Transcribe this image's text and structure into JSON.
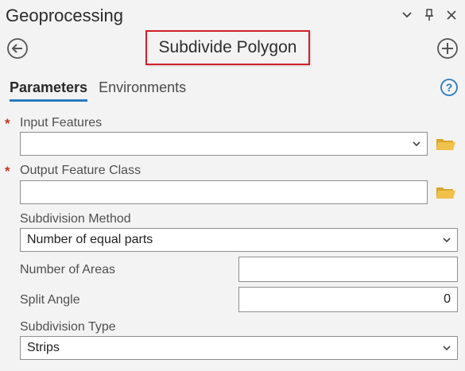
{
  "pane": {
    "title": "Geoprocessing",
    "tool_title": "Subdivide Polygon"
  },
  "tabs": [
    {
      "label": "Parameters",
      "active": true
    },
    {
      "label": "Environments",
      "active": false
    }
  ],
  "params": {
    "input_features": {
      "label": "Input Features",
      "required_mark": "*",
      "value": ""
    },
    "output_feature_class": {
      "label": "Output Feature Class",
      "required_mark": "*",
      "value": ""
    },
    "subdivision_method": {
      "label": "Subdivision Method",
      "value": "Number of equal parts"
    },
    "number_of_areas": {
      "label": "Number of Areas",
      "value": ""
    },
    "split_angle": {
      "label": "Split Angle",
      "value": "0"
    },
    "subdivision_type": {
      "label": "Subdivision Type",
      "value": "Strips"
    }
  },
  "icons": {
    "back": "arrow-left-circle",
    "add": "plus-circle",
    "help": "question-circle",
    "browse": "folder-open",
    "dropdown": "chevron-down",
    "pane_menu": "chevron-down",
    "pin": "pin",
    "close": "close"
  },
  "colors": {
    "highlight_border": "#d11f2a",
    "tab_underline": "#2a7bbf",
    "required": "#c0392b",
    "folder": "#e7b43a",
    "help": "#2a7bbf"
  }
}
